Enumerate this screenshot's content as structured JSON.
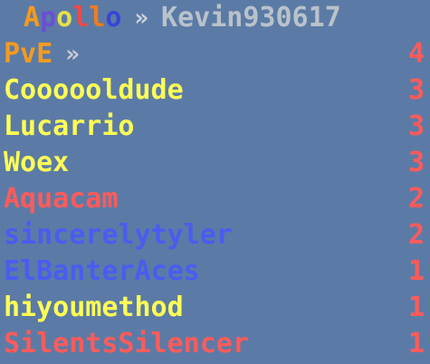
{
  "header": {
    "server_name_letters": [
      {
        "ch": "A",
        "color": "#f59a1f"
      },
      {
        "ch": "p",
        "color": "#6b4fd6"
      },
      {
        "ch": "o",
        "color": "#e6e04a"
      },
      {
        "ch": "l",
        "color": "#ee4a4a"
      },
      {
        "ch": "l",
        "color": "#f07c1c"
      },
      {
        "ch": "o",
        "color": "#3846d6"
      }
    ],
    "separator": "»",
    "player_name": "Kevin930617"
  },
  "category": {
    "label": "PvE",
    "separator": "»",
    "score": "4",
    "label_color": "#f59a1f",
    "score_color": "#ff5b5b"
  },
  "entries": [
    {
      "name": "Coooooldude",
      "score": "3",
      "name_color": "#ffff55",
      "score_color": "#ff5b5b"
    },
    {
      "name": "Lucarrio",
      "score": "3",
      "name_color": "#ffff55",
      "score_color": "#ff5b5b"
    },
    {
      "name": "Woex",
      "score": "3",
      "name_color": "#ffff55",
      "score_color": "#ff5b5b"
    },
    {
      "name": "Aquacam",
      "score": "2",
      "name_color": "#ff5b5b",
      "score_color": "#ff5b5b"
    },
    {
      "name": "sincerelytyler",
      "score": "2",
      "name_color": "#4a5cf0",
      "score_color": "#ff5b5b"
    },
    {
      "name": "ElBanterAces",
      "score": "1",
      "name_color": "#4a5cf0",
      "score_color": "#ff5b5b"
    },
    {
      "name": "hiyoumethod",
      "score": "1",
      "name_color": "#ffff55",
      "score_color": "#ff5b5b"
    },
    {
      "name": "SilentsSilencer",
      "score": "1",
      "name_color": "#ff5b5b",
      "score_color": "#ff5b5b"
    }
  ]
}
